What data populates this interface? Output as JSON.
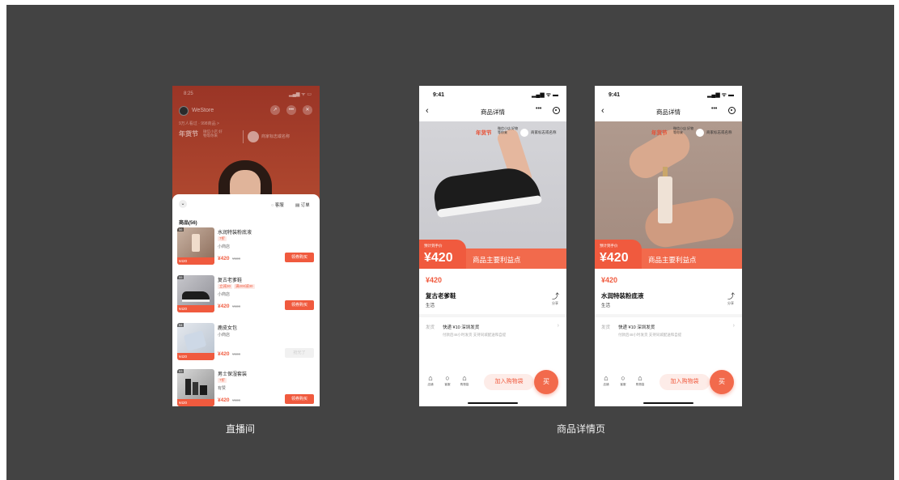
{
  "captions": {
    "live": "直播间",
    "detail": "商品详情页"
  },
  "live": {
    "status_time": "8:25",
    "signal": "▂▄▆ ᯤ ▭",
    "store_name": "WeStore",
    "viewers": "9万人看过 · 998商品 >",
    "festival": "年货节",
    "festival_sub": "微信小店 好物等你来",
    "brand": "商家标志或名称",
    "sheet": {
      "service": "客服",
      "orders": "订单",
      "goods_title": "商品(56)",
      "items": [
        {
          "num": "56",
          "name": "水润特装粉底液",
          "tags": [
            "7折"
          ],
          "shop": "小商店",
          "price": "¥420",
          "orig": "¥588",
          "badge": "¥420",
          "button": "领券购买",
          "enabled": true
        },
        {
          "num": "55",
          "name": "复古老爹鞋",
          "tags": [
            "立减30",
            "满200减30"
          ],
          "shop": "小商店",
          "price": "¥420",
          "orig": "¥588",
          "badge": "¥420",
          "button": "领券购买",
          "enabled": true
        },
        {
          "num": "54",
          "name": "鹿皮女包",
          "tags": [],
          "shop": "小商店",
          "price": "¥420",
          "orig": "¥588",
          "badge": "¥420",
          "button": "抢光了",
          "enabled": false
        },
        {
          "num": "53",
          "name": "男士保湿套装",
          "tags": [
            "7折"
          ],
          "shop": "有赞",
          "price": "¥420",
          "orig": "¥588",
          "badge": "¥420",
          "button": "领券购买",
          "enabled": true
        }
      ]
    }
  },
  "details": [
    {
      "time": "9:41",
      "signal": "▂▄▆ ᯤ ▬",
      "nav_title": "商品详情",
      "festival": "年货节",
      "festival_sub": "微信小店 好物等你来",
      "brand": "商家标志或名称",
      "est_label": "预计到手价",
      "big_price": "¥420",
      "benefit": "商品主要利益点",
      "price": "¥420",
      "name": "复古老爹鞋",
      "category": "生活",
      "share": "分享",
      "ship_label": "发货",
      "ship": "快递 ¥10  深圳发货",
      "ship_sub": "付款后48小时发货   支持同城配送和自提",
      "shop_label": "店铺",
      "service_label": "客服",
      "cart_label": "购物袋",
      "add_cart": "加入购物袋",
      "buy": "买"
    },
    {
      "time": "9:41",
      "signal": "▂▄▆ ᯤ ▬",
      "nav_title": "商品详情",
      "festival": "年货节",
      "festival_sub": "微信小店 好物等你来",
      "brand": "商家标志或名称",
      "est_label": "预计到手价",
      "big_price": "¥420",
      "benefit": "商品主要利益点",
      "price": "¥420",
      "name": "水润特装粉底液",
      "category": "生活",
      "share": "分享",
      "ship_label": "发货",
      "ship": "快递 ¥10  深圳发货",
      "ship_sub": "付款后48小时发货   支持同城配送和自提",
      "shop_label": "店铺",
      "service_label": "客服",
      "cart_label": "购物袋",
      "add_cart": "加入购物袋",
      "buy": "买"
    }
  ],
  "colors": {
    "accent": "#f05a3e",
    "board": "#434343",
    "live_bg": "#b5402c"
  },
  "icons": [
    "back-icon",
    "more-icon",
    "record-icon",
    "share-icon",
    "home-icon",
    "chat-icon",
    "bag-icon",
    "chevron-right-icon",
    "headset-icon",
    "order-icon",
    "chevron-down-icon"
  ]
}
